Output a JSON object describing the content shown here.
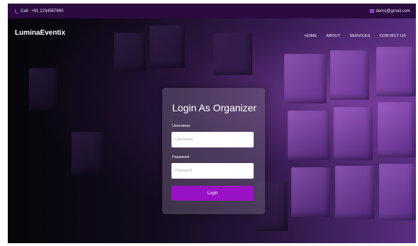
{
  "topbar": {
    "phone": "Call : +91 1234567890",
    "email": "demo@gmail.com"
  },
  "brand": "LuminaEventix",
  "nav": [
    "HOME",
    "ABOUT",
    "SERVICES",
    "CONTACT US"
  ],
  "login": {
    "title": "Login As Organizer",
    "username_label": "Username",
    "username_placeholder": "Username",
    "password_label": "Password",
    "password_placeholder": "Password",
    "button_label": "Login"
  }
}
